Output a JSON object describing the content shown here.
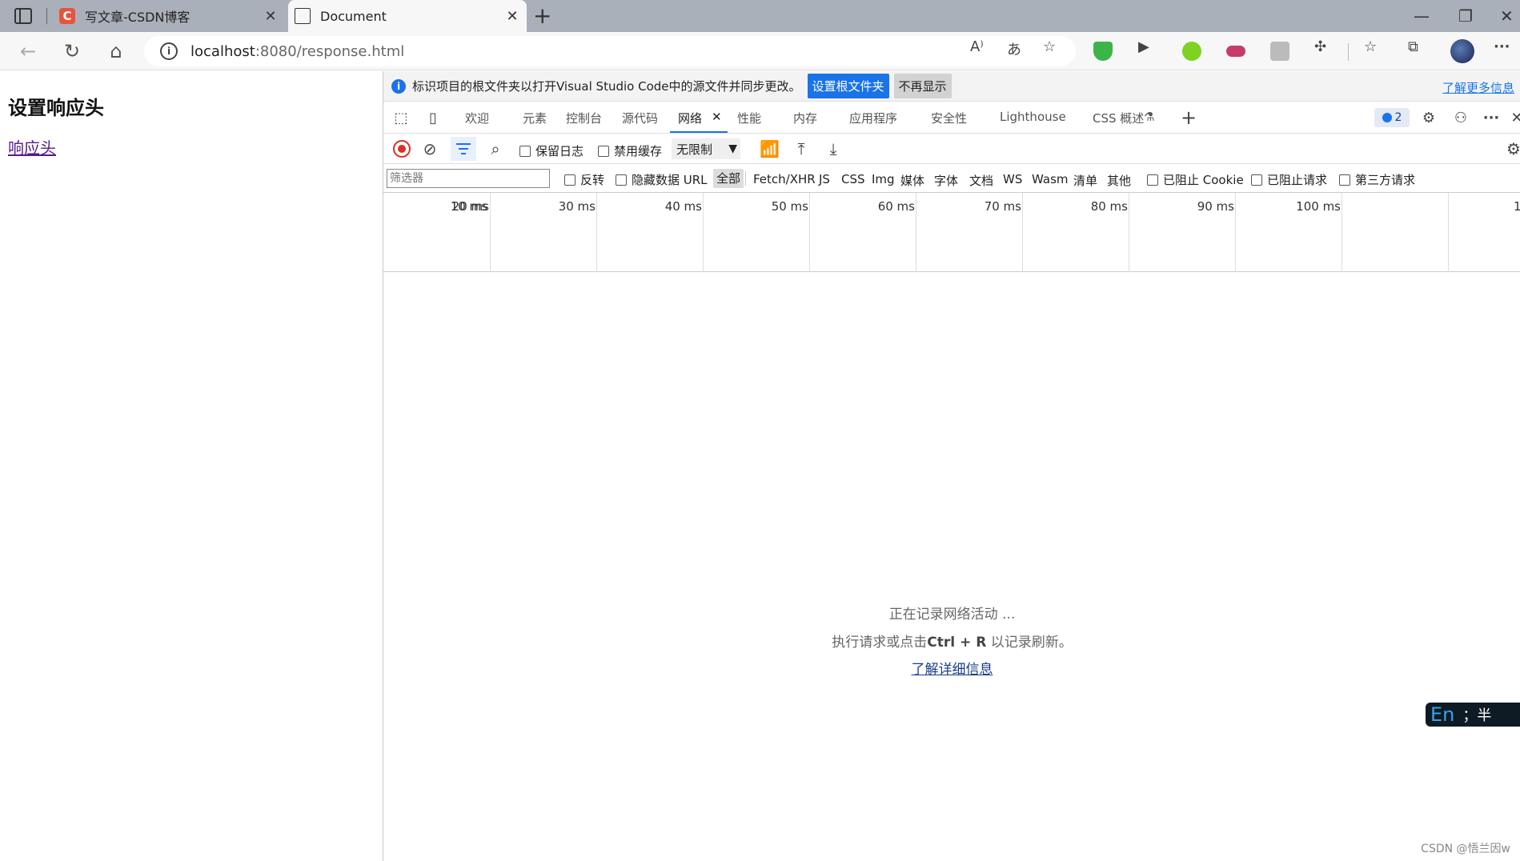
{
  "browser": {
    "tabs": [
      {
        "title": "写文章-CSDN博客",
        "favicon": "C",
        "active": false
      },
      {
        "title": "Document",
        "favicon": "document-icon",
        "active": true
      }
    ],
    "close_glyph": "✕",
    "new_tab_glyph": "+",
    "window_controls": [
      "—",
      "❐",
      "✕"
    ],
    "url_host": "localhost",
    "url_path": ":8080/response.html",
    "more_glyph": "···"
  },
  "page": {
    "heading": "设置响应头",
    "link": "响应头"
  },
  "devtools": {
    "infobar": {
      "message": "标识项目的根文件夹以打开Visual Studio Code中的源文件并同步更改。",
      "primary_button": "设置根文件夹",
      "secondary_button": "不再显示",
      "learn_more": "了解更多信息"
    },
    "tabs": [
      "欢迎",
      "元素",
      "控制台",
      "源代码",
      "网络",
      "性能",
      "内存",
      "应用程序",
      "安全性",
      "Lighthouse",
      "CSS 概述"
    ],
    "active_tab": "网络",
    "issues_count": "2",
    "toolbar": {
      "preserve_log": "保留日志",
      "disable_cache": "禁用缓存",
      "throttle": "无限制"
    },
    "filter": {
      "placeholder": "筛选器",
      "invert": "反转",
      "hide_data_url": "隐藏数据 URL",
      "types": [
        "全部",
        "Fetch/XHR",
        "JS",
        "CSS",
        "Img",
        "媒体",
        "字体",
        "文档",
        "WS",
        "Wasm",
        "清单",
        "其他"
      ],
      "active_type": "全部",
      "blocked_cookies": "已阻止 Cookie",
      "blocked_requests": "已阻止请求",
      "third_party": "第三方请求"
    },
    "timeline_ticks": [
      "10 ms",
      "20 ms",
      "30 ms",
      "40 ms",
      "50 ms",
      "60 ms",
      "70 ms",
      "80 ms",
      "90 ms",
      "100 ms",
      "1"
    ],
    "empty_state": {
      "line1": "正在记录网络活动 ...",
      "line2_prefix": "执行请求或点击",
      "line2_key": "Ctrl + R",
      "line2_suffix": " 以记录刷新。",
      "link": "了解详细信息"
    }
  },
  "ime": {
    "lang": "En",
    "mode": "；半"
  },
  "watermark": "CSDN @悟兰因w"
}
